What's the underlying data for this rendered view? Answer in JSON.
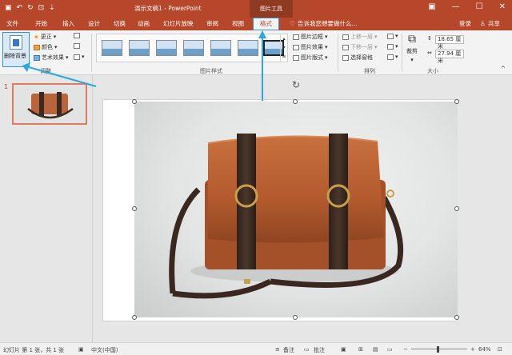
{
  "qat": {
    "save_icon": "save-icon",
    "undo_icon": "undo-icon",
    "redo_icon": "redo-icon",
    "present_icon": "present-icon",
    "more_icon": "more-icon"
  },
  "window": {
    "title": "演示文稿1 - PowerPoint",
    "tool_context": "图片工具"
  },
  "window_controls": {
    "ribbon_opts": "▣",
    "minimize": "—",
    "maximize": "☐",
    "close": "✕"
  },
  "tabs": [
    "文件",
    "开始",
    "插入",
    "设计",
    "切换",
    "动画",
    "幻灯片放映",
    "审阅",
    "视图",
    "格式"
  ],
  "tell_me": "告诉我您想要做什么...",
  "account": {
    "signin": "登录",
    "share": "共享"
  },
  "ribbon": {
    "adjust": {
      "remove_bg": "删除背景",
      "corrections": "更正",
      "color": "颜色",
      "artistic": "艺术效果",
      "group_label": "调整"
    },
    "picture_styles": {
      "border": "图片边框",
      "effects": "图片效果",
      "layout": "图片版式",
      "group_label": "图片样式"
    },
    "arrange": {
      "bring_forward": "上移一层",
      "send_backward": "下移一层",
      "selection_pane": "选择窗格",
      "group_label": "排列"
    },
    "size": {
      "crop": "裁剪",
      "height": "18.65 厘米",
      "width": "27.94 厘米",
      "group_label": "大小"
    }
  },
  "slides": {
    "current_number": "1"
  },
  "status": {
    "slide_info": "幻灯片 第 1 张，共 1 张",
    "language": "中文(中国)",
    "notes": "备注",
    "comments": "批注",
    "zoom": "64%"
  },
  "colors": {
    "accent": "#b7472a",
    "highlight": "#3b8ed8",
    "arrow": "#29a8e0"
  }
}
